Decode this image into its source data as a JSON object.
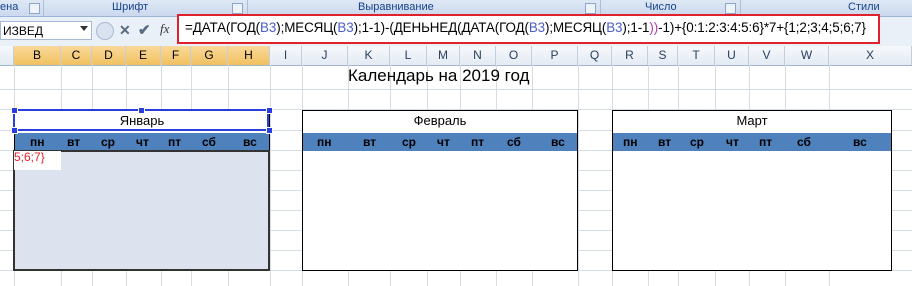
{
  "ribbon": {
    "groups": [
      "ена",
      "Шрифт",
      "Выравнивание",
      "Число",
      "Стили"
    ]
  },
  "formula_bar": {
    "name_box": "ИЗВЕД",
    "cancel": "✕",
    "enter": "✔",
    "fx": "fx",
    "formula_parts": [
      {
        "t": "=ДАТА(ГОД(",
        "c": ""
      },
      {
        "t": "B3",
        "c": "ref"
      },
      {
        "t": ");МЕСЯЦ(",
        "c": ""
      },
      {
        "t": "B3",
        "c": "ref"
      },
      {
        "t": ");1-1)-(ДЕНЬНЕД(ДАТА(ГОД(",
        "c": ""
      },
      {
        "t": "B3",
        "c": "ref"
      },
      {
        "t": ");МЕСЯЦ(",
        "c": ""
      },
      {
        "t": "B3",
        "c": "ref"
      },
      {
        "t": ");1-1",
        "c": ""
      },
      {
        "t": "))",
        "c": "ref2"
      },
      {
        "t": "-1)+{0:1:2:3:4:5:6}*7+{1;2;3;4;5;6;7}",
        "c": ""
      }
    ]
  },
  "columns": [
    "B",
    "C",
    "D",
    "E",
    "F",
    "G",
    "H",
    "I",
    "J",
    "K",
    "L",
    "M",
    "N",
    "O",
    "P",
    "Q",
    "R",
    "S",
    "T",
    "U",
    "V",
    "W",
    "X"
  ],
  "sheet": {
    "title": "Календарь на 2019 год",
    "cell_value": "5;6;7}"
  },
  "months": [
    {
      "name": "Январь",
      "weekdays": [
        "пн",
        "вт",
        "ср",
        "чт",
        "пт",
        "сб",
        "вс"
      ]
    },
    {
      "name": "Февраль",
      "weekdays": [
        "пн",
        "вт",
        "ср",
        "чт",
        "пт",
        "сб",
        "вс"
      ]
    },
    {
      "name": "Март",
      "weekdays": [
        "пн",
        "вт",
        "ср",
        "чт",
        "пт",
        "сб",
        "вс"
      ]
    }
  ]
}
